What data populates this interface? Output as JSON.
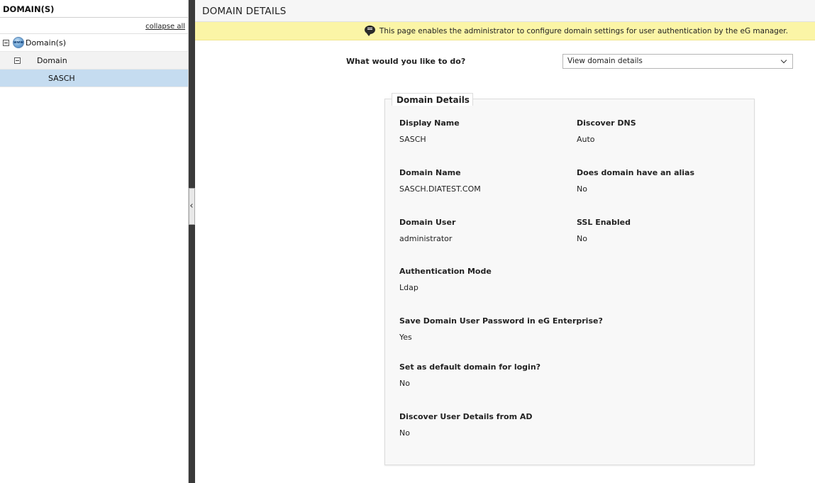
{
  "left": {
    "header": "DOMAIN(S)",
    "collapse_all": "collapse all",
    "tree": {
      "root_label": "Domain(s)",
      "root_icon": "www-globe-icon",
      "group_label": "Domain",
      "selected_item": "SASCH"
    }
  },
  "right": {
    "title": "DOMAIN DETAILS",
    "info_text": "This page enables the administrator to configure domain settings for user authentication by the eG manager.",
    "question_label": "What would you like to do?",
    "action_select": "View domain details",
    "card": {
      "title": "Domain Details",
      "display_name_label": "Display Name",
      "display_name_value": "SASCH",
      "discover_dns_label": "Discover DNS",
      "discover_dns_value": "Auto",
      "domain_name_label": "Domain Name",
      "domain_name_value": "SASCH.DIATEST.COM",
      "alias_label": "Does domain have an alias",
      "alias_value": "No",
      "domain_user_label": "Domain User",
      "domain_user_value": "administrator",
      "ssl_label": "SSL Enabled",
      "ssl_value": "No",
      "auth_mode_label": "Authentication Mode",
      "auth_mode_value": "Ldap",
      "save_password_label": "Save Domain User Password in eG Enterprise?",
      "save_password_value": "Yes",
      "default_domain_label": "Set as default domain for login?",
      "default_domain_value": "No",
      "discover_ad_label": "Discover User Details from AD",
      "discover_ad_value": "No"
    }
  },
  "colors": {
    "info_bar": "#fbf5a6",
    "selected_row": "#c5dcf0",
    "splitter": "#3a3a3a"
  }
}
